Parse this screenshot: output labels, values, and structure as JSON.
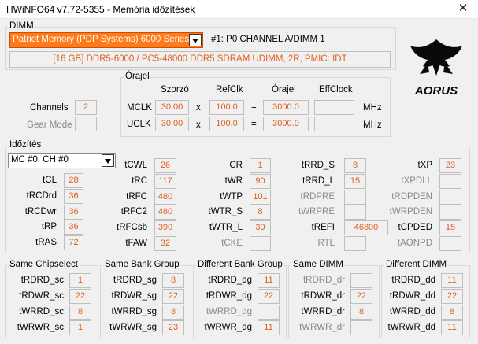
{
  "window": {
    "title": "HWiNFO64 v7.72-5355 - Memória időzítések",
    "close_glyph": "✕"
  },
  "dimm": {
    "group_label": "DIMM",
    "selected_module": "Patriot Memory (PDP Systems) 6000 Series",
    "slot_label": "#1: P0 CHANNEL A/DIMM 1",
    "description": "[16 GB] DDR5-6000 / PC5-48000 DDR5 SDRAM UDIMM, 2R, PMIC: IDT"
  },
  "logo": {
    "text": "AORUS"
  },
  "channels": {
    "label": "Channels",
    "value": "2",
    "gear_label": "Gear Mode",
    "gear_value": ""
  },
  "clock": {
    "group_label": "Órajel",
    "headers": {
      "mult": "Szorzó",
      "ref": "RefClk",
      "clock": "Órajel",
      "eff": "EffClock"
    },
    "rows": [
      {
        "label": "MCLK",
        "mult": "30.00",
        "x": "x",
        "ref": "100.0",
        "eq": "=",
        "clock": "3000.0",
        "eff": "",
        "unit": "MHz"
      },
      {
        "label": "UCLK",
        "mult": "30.00",
        "x": "x",
        "ref": "100.0",
        "eq": "=",
        "clock": "3000.0",
        "eff": "",
        "unit": "MHz"
      }
    ]
  },
  "timings": {
    "group_label": "Időzítés",
    "selected": "MC #0, CH #0",
    "cols": [
      [
        {
          "label": "tCL",
          "value": "28"
        },
        {
          "label": "tRCDrd",
          "value": "36"
        },
        {
          "label": "tRCDwr",
          "value": "36"
        },
        {
          "label": "tRP",
          "value": "36"
        },
        {
          "label": "tRAS",
          "value": "72"
        }
      ],
      [
        {
          "label": "tCWL",
          "value": "26"
        },
        {
          "label": "tRC",
          "value": "117"
        },
        {
          "label": "tRFC",
          "value": "480"
        },
        {
          "label": "tRFC2",
          "value": "480"
        },
        {
          "label": "tRFCsb",
          "value": "390"
        },
        {
          "label": "tFAW",
          "value": "32"
        }
      ],
      [
        {
          "label": "CR",
          "value": "1"
        },
        {
          "label": "tWR",
          "value": "90"
        },
        {
          "label": "tWTP",
          "value": "101"
        },
        {
          "label": "tWTR_S",
          "value": "8"
        },
        {
          "label": "tWTR_L",
          "value": "30"
        },
        {
          "label": "tCKE",
          "value": "",
          "dim": true
        }
      ],
      [
        {
          "label": "tRRD_S",
          "value": "8"
        },
        {
          "label": "tRRD_L",
          "value": "15"
        },
        {
          "label": "tRDPRE",
          "value": "",
          "dim": true
        },
        {
          "label": "tWRPRE",
          "value": "",
          "dim": true
        },
        {
          "label": "tREFI",
          "value": "46800"
        },
        {
          "label": "RTL",
          "value": "",
          "dim": true
        }
      ],
      [
        {
          "label": "tXP",
          "value": "23"
        },
        {
          "label": "tXPDLL",
          "value": "",
          "dim": true
        },
        {
          "label": "tRDPDEN",
          "value": "",
          "dim": true
        },
        {
          "label": "tWRPDEN",
          "value": "",
          "dim": true
        },
        {
          "label": "tCPDED",
          "value": "15"
        },
        {
          "label": "tAONPD",
          "value": "",
          "dim": true
        }
      ]
    ]
  },
  "groups": [
    {
      "label": "Same Chipselect",
      "rows": [
        {
          "label": "tRDRD_sc",
          "value": "1"
        },
        {
          "label": "tRDWR_sc",
          "value": "22"
        },
        {
          "label": "tWRRD_sc",
          "value": "8"
        },
        {
          "label": "tWRWR_sc",
          "value": "1"
        }
      ]
    },
    {
      "label": "Same Bank Group",
      "rows": [
        {
          "label": "tRDRD_sg",
          "value": "8"
        },
        {
          "label": "tRDWR_sg",
          "value": "22"
        },
        {
          "label": "tWRRD_sg",
          "value": "8"
        },
        {
          "label": "tWRWR_sg",
          "value": "23"
        }
      ]
    },
    {
      "label": "Different Bank Group",
      "rows": [
        {
          "label": "tRDRD_dg",
          "value": "11"
        },
        {
          "label": "tRDWR_dg",
          "value": "22"
        },
        {
          "label": "tWRRD_dg",
          "value": "",
          "dim": true
        },
        {
          "label": "tWRWR_dg",
          "value": "11"
        }
      ]
    },
    {
      "label": "Same DIMM",
      "rows": [
        {
          "label": "tRDRD_dr",
          "value": "",
          "dim": true
        },
        {
          "label": "tRDWR_dr",
          "value": "22"
        },
        {
          "label": "tWRRD_dr",
          "value": "8"
        },
        {
          "label": "tWRWR_dr",
          "value": "",
          "dim": true
        }
      ]
    },
    {
      "label": "Different DIMM",
      "rows": [
        {
          "label": "tRDRD_dd",
          "value": "11"
        },
        {
          "label": "tRDWR_dd",
          "value": "22"
        },
        {
          "label": "tWRRD_dd",
          "value": "8"
        },
        {
          "label": "tWRWR_dd",
          "value": "11"
        }
      ]
    }
  ],
  "colors": {
    "accent": "#ff7a1a",
    "value_text": "#e06020"
  }
}
